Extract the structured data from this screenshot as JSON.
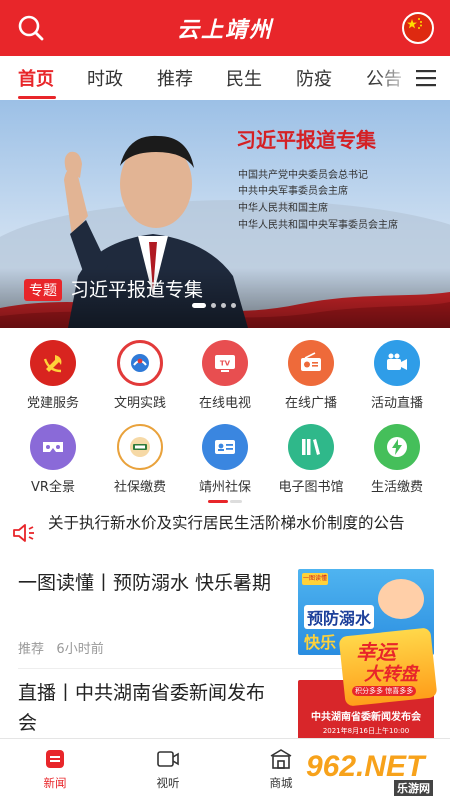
{
  "header": {
    "title": "云上靖州",
    "search_icon": "search-icon",
    "avatar_icon": "china-flag-avatar",
    "brand_color": "#e8262a"
  },
  "tabs": [
    {
      "label": "首页",
      "active": true
    },
    {
      "label": "时政"
    },
    {
      "label": "推荐"
    },
    {
      "label": "民生"
    },
    {
      "label": "防疫"
    },
    {
      "label": "公告"
    }
  ],
  "banner": {
    "title": "习近平报道专集",
    "subtitles": [
      "中国共产党中央委员会总书记",
      "中共中央军事委员会主席",
      "中华人民共和国主席",
      "中华人民共和国中央军事委员会主席"
    ],
    "tag": "专题",
    "caption": "习近平报道专集",
    "slide_count": 4,
    "active_slide": 1
  },
  "services": [
    {
      "label": "党建服务",
      "icon": "party-emblem-icon",
      "color": "#d8241f"
    },
    {
      "label": "文明实践",
      "icon": "civilization-badge-icon",
      "color": "#e23a3a"
    },
    {
      "label": "在线电视",
      "icon": "tv-icon",
      "color": "#e84e50"
    },
    {
      "label": "在线广播",
      "icon": "radio-icon",
      "color": "#ee6a3a"
    },
    {
      "label": "活动直播",
      "icon": "video-camera-icon",
      "color": "#2f9de8"
    },
    {
      "label": "VR全景",
      "icon": "vr-glasses-icon",
      "color": "#8a6ad8"
    },
    {
      "label": "社保缴费",
      "icon": "social-security-badge-icon",
      "color": "#e9a23c"
    },
    {
      "label": "靖州社保",
      "icon": "id-card-icon",
      "color": "#3a86e0"
    },
    {
      "label": "电子图书馆",
      "icon": "books-icon",
      "color": "#2fb88a"
    },
    {
      "label": "生活缴费",
      "icon": "lightning-icon",
      "color": "#45bf5a"
    }
  ],
  "notice": {
    "text": "关于执行新水价及实行居民生活阶梯水价制度的公告",
    "icon": "speaker-icon"
  },
  "news": [
    {
      "title": "一图读懂丨预防溺水 快乐暑期",
      "category": "推荐",
      "time": "6小时前",
      "thumb_text_1": "预防溺水",
      "thumb_text_2": "快乐",
      "thumb_badge": "一图读懂"
    },
    {
      "title": "直播丨中共湖南省委新闻发布会",
      "thumb_text": "中共湖南省委新闻发布会",
      "thumb_date": "2021年8月16日上午10:00"
    }
  ],
  "promo": {
    "line1": "幸运",
    "line2": "大转盘",
    "sub": "积分多多 惊喜多多"
  },
  "bottom_nav": [
    {
      "label": "新闻",
      "icon": "news-icon",
      "active": true
    },
    {
      "label": "视听",
      "icon": "video-icon"
    },
    {
      "label": "商城",
      "icon": "shop-icon"
    }
  ],
  "watermark": {
    "brand": "962.NET",
    "sub": "乐游网"
  }
}
